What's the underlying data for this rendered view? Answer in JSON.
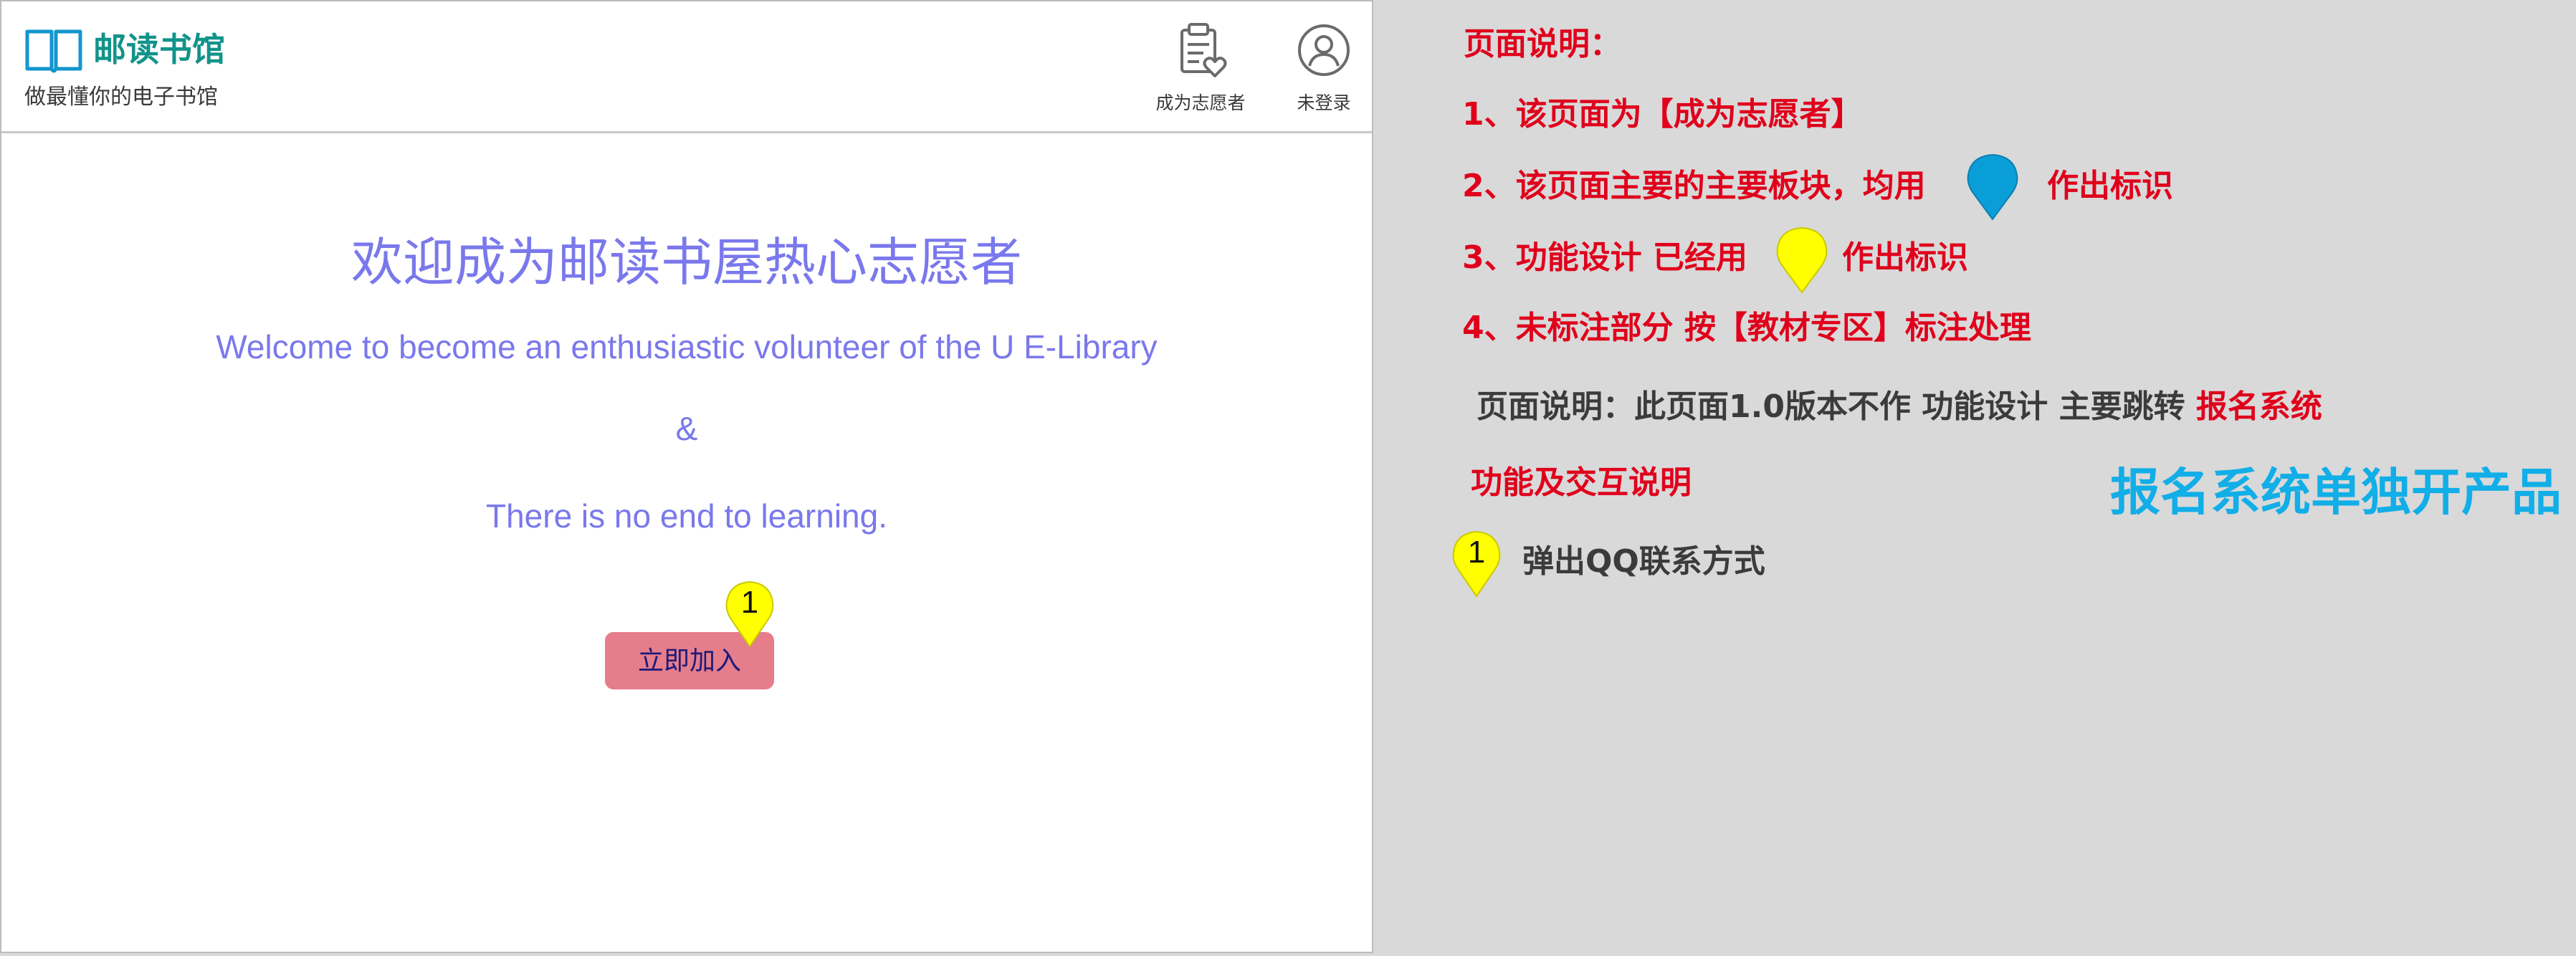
{
  "app": {
    "brand_name": "邮读书馆",
    "slogan": "做最懂你的电子书馆",
    "brand_icon": "open-book-icon",
    "brand_color": "#11938a"
  },
  "header_actions": {
    "volunteer": {
      "label": "成为志愿者",
      "icon": "clipboard-heart-icon"
    },
    "login": {
      "label": "未登录",
      "icon": "user-circle-icon"
    }
  },
  "welcome": {
    "title": "欢迎成为邮读书屋热心志愿者",
    "subtitle_en": "Welcome to become an enthusiastic volunteer of the U E-Library",
    "ampersand": "&",
    "motto": "There is no end to learning.",
    "join_button": "立即加入",
    "text_color": "#7a78ec",
    "button_color": "#e57d8b"
  },
  "annotation_pin": {
    "number": "1",
    "color": "#ffff00"
  },
  "notes": {
    "heading": "页面说明：",
    "items": [
      "1、该页面为【成为志愿者】",
      "2、该页面主要的主要板块，均用",
      "3、功能设计 已经用",
      "4、未标注部分 按【教材专区】标注处理"
    ],
    "marker_suffix": "作出标识",
    "blue_pin_color": "#0a9ed9",
    "yellow_pin_color": "#ffff00",
    "page_desc": "页面说明：此页面1.0版本不作 功能设计 主要跳转",
    "page_desc_link": "报名系统",
    "func_heading": "功能及交互说明",
    "standalone_note": "报名系统单独开产品",
    "func_items": [
      {
        "number": "1",
        "text": "弹出QQ联系方式"
      }
    ]
  }
}
